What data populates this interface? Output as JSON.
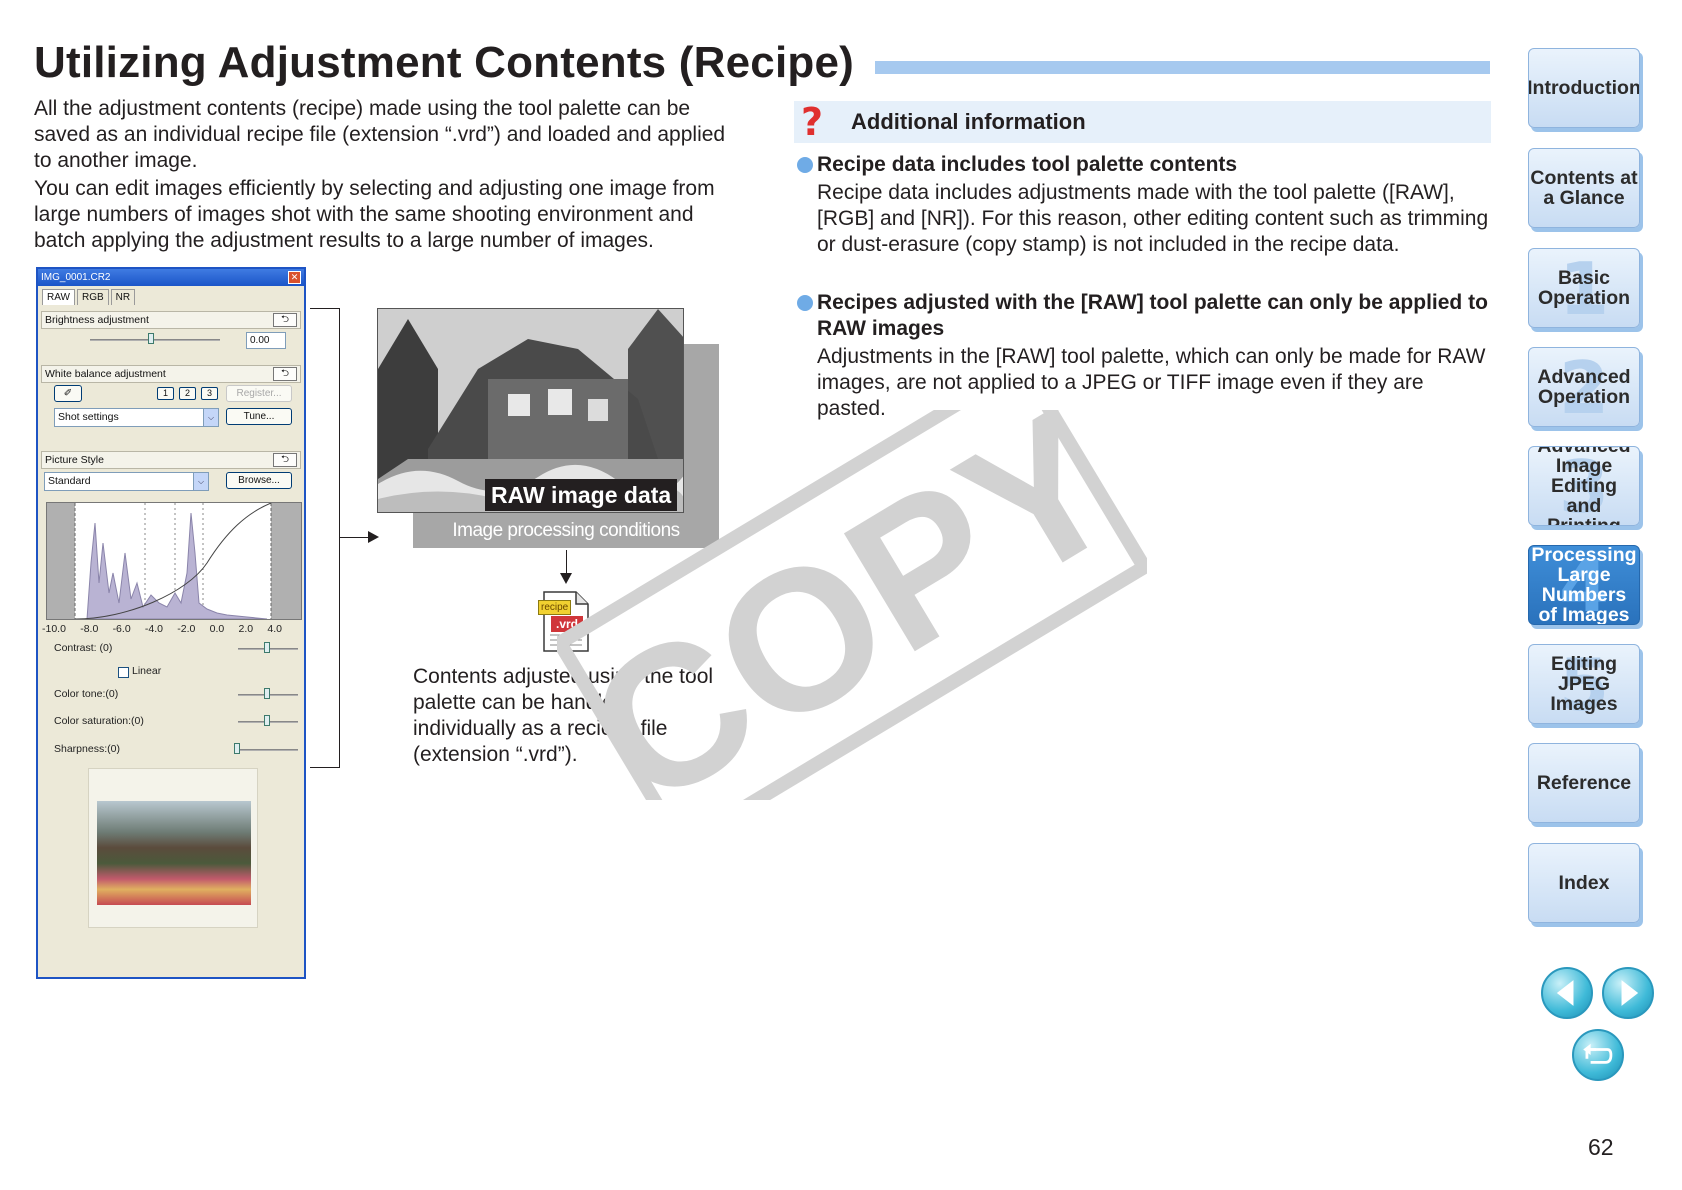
{
  "title": "Utilizing Adjustment Contents (Recipe)",
  "intro": {
    "paragraph1": "All the adjustment contents (recipe) made using the tool palette can be saved as an individual recipe file (extension “.vrd”) and loaded and applied to another image.",
    "paragraph2": "You can edit images efficiently by selecting and adjusting one image from large numbers of images shot with the same shooting environment and batch applying the adjustment results to a large number of images."
  },
  "palette": {
    "window_title": "IMG_0001.CR2",
    "close_glyph": "✕",
    "tabs": [
      "RAW",
      "RGB",
      "NR"
    ],
    "brightness": {
      "label": "Brightness adjustment",
      "value": "0.00"
    },
    "white_balance": {
      "label": "White balance adjustment",
      "presets": [
        "1",
        "2",
        "3"
      ],
      "register_label": "Register...",
      "select_value": "Shot settings",
      "tune_label": "Tune..."
    },
    "picture_style": {
      "label": "Picture Style",
      "select_value": "Standard",
      "browse_label": "Browse..."
    },
    "reset_glyph": "⮌",
    "dropdown_glyph": "⌵",
    "eyedropper_glyph": "✐",
    "histogram_axis": [
      "-10.0",
      "-8.0",
      "-6.0",
      "-4.0",
      "-2.0",
      "0.0",
      "2.0",
      "4.0"
    ],
    "contrast_label": "Contrast: (0)",
    "linear_label": "Linear",
    "color_tone_label": "Color tone:(0)",
    "color_saturation_label": "Color saturation:(0)",
    "sharpness_label": "Sharpness:(0)"
  },
  "diagram": {
    "raw_label": "RAW image data",
    "conditions_label": "Image processing conditions information",
    "recipe_tag": "recipe",
    "vrd_tag": ".vrd",
    "caption": "Contents adjusted using the tool palette can be handled individually as a recicpe file (extension “.vrd”)."
  },
  "watermark": "COPY",
  "additional": {
    "icon_glyph": "?",
    "heading": "Additional information",
    "items": [
      {
        "title": "Recipe data includes tool palette contents",
        "body": "Recipe data includes adjustments made with the tool palette ([RAW], [RGB] and [NR]). For this reason, other editing content such as trimming or dust-erasure (copy stamp) is not included in the recipe data."
      },
      {
        "title": "Recipes adjusted with the [RAW] tool palette can only be applied to RAW images",
        "body": "Adjustments in the [RAW] tool palette, which can only be made for RAW images, are not applied to a JPEG or TIFF image even if they are pasted."
      }
    ]
  },
  "nav": {
    "items": [
      {
        "label": "Introduction",
        "num": ""
      },
      {
        "label": "Contents at\na Glance",
        "num": ""
      },
      {
        "label": "Basic\nOperation",
        "num": "1"
      },
      {
        "label": "Advanced\nOperation",
        "num": "2"
      },
      {
        "label": "Advanced\nImage Editing\nand Printing",
        "num": "3"
      },
      {
        "label": "Processing\nLarge Numbers\nof Images",
        "num": "4",
        "active": true
      },
      {
        "label": "Editing JPEG\nImages",
        "num": "5"
      },
      {
        "label": "Reference",
        "num": ""
      },
      {
        "label": "Index",
        "num": ""
      }
    ],
    "prev_icon": "prev-page-icon",
    "next_icon": "next-page-icon",
    "back_icon": "return-icon"
  },
  "page_number": "62",
  "colors": {
    "accent_blue": "#a6c9ef",
    "nav_active": "#2a72bc",
    "info_bg": "#e6f0fa",
    "question_red": "#e0302f",
    "bullet_blue": "#6fabe6"
  }
}
